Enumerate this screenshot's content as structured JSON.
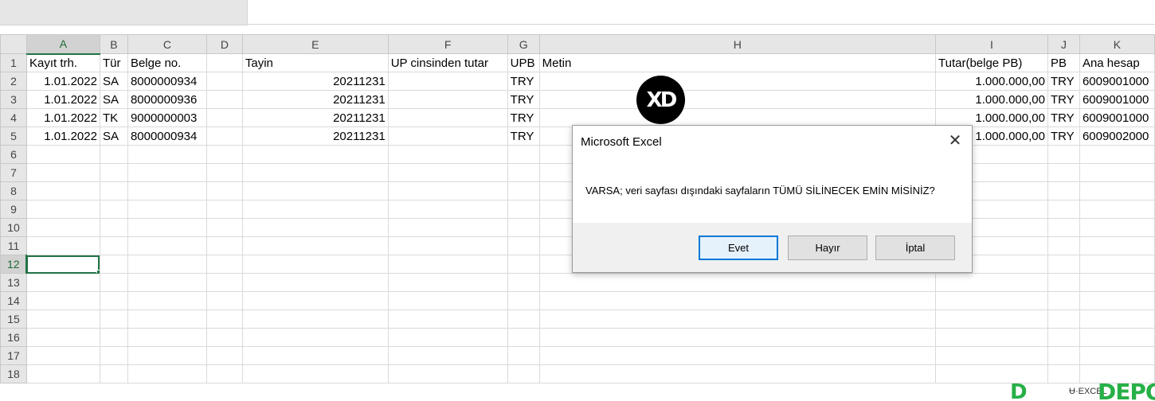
{
  "columns": [
    "A",
    "B",
    "C",
    "D",
    "E",
    "F",
    "G",
    "H",
    "I",
    "J",
    "K"
  ],
  "rows": [
    {
      "num": "1",
      "cells": [
        "Kayıt trh.",
        "Tür",
        "Belge no.",
        "",
        "Tayin",
        "UP cinsinden tutar",
        "UPB",
        "Metin",
        "Tutar(belge PB)",
        "PB",
        "Ana hesap"
      ]
    },
    {
      "num": "2",
      "cells": [
        "1.01.2022",
        "SA",
        "8000000934",
        "",
        "20211231",
        "",
        "TRY",
        "",
        "1.000.000,00",
        "TRY",
        "6009001000"
      ]
    },
    {
      "num": "3",
      "cells": [
        "1.01.2022",
        "SA",
        "8000000936",
        "",
        "20211231",
        "",
        "TRY",
        "",
        "1.000.000,00",
        "TRY",
        "6009001000"
      ]
    },
    {
      "num": "4",
      "cells": [
        "1.01.2022",
        "TK",
        "9000000003",
        "",
        "20211231",
        "",
        "TRY",
        "",
        "1.000.000,00",
        "TRY",
        "6009001000"
      ]
    },
    {
      "num": "5",
      "cells": [
        "1.01.2022",
        "SA",
        "8000000934",
        "",
        "20211231",
        "",
        "TRY",
        "",
        "1.000.000,00",
        "TRY",
        "6009002000"
      ]
    },
    {
      "num": "6",
      "cells": [
        "",
        "",
        "",
        "",
        "",
        "",
        "",
        "",
        "",
        "",
        ""
      ]
    },
    {
      "num": "7",
      "cells": [
        "",
        "",
        "",
        "",
        "",
        "",
        "",
        "",
        "",
        "",
        ""
      ]
    },
    {
      "num": "8",
      "cells": [
        "",
        "",
        "",
        "",
        "",
        "",
        "",
        "",
        "",
        "",
        ""
      ]
    },
    {
      "num": "9",
      "cells": [
        "",
        "",
        "",
        "",
        "",
        "",
        "",
        "",
        "",
        "",
        ""
      ]
    },
    {
      "num": "10",
      "cells": [
        "",
        "",
        "",
        "",
        "",
        "",
        "",
        "",
        "",
        "",
        ""
      ]
    },
    {
      "num": "11",
      "cells": [
        "",
        "",
        "",
        "",
        "",
        "",
        "",
        "",
        "",
        "",
        ""
      ]
    },
    {
      "num": "12",
      "cells": [
        "",
        "",
        "",
        "",
        "",
        "",
        "",
        "",
        "",
        "",
        ""
      ]
    },
    {
      "num": "13",
      "cells": [
        "",
        "",
        "",
        "",
        "",
        "",
        "",
        "",
        "",
        "",
        ""
      ]
    },
    {
      "num": "14",
      "cells": [
        "",
        "",
        "",
        "",
        "",
        "",
        "",
        "",
        "",
        "",
        ""
      ]
    },
    {
      "num": "15",
      "cells": [
        "",
        "",
        "",
        "",
        "",
        "",
        "",
        "",
        "",
        "",
        ""
      ]
    },
    {
      "num": "16",
      "cells": [
        "",
        "",
        "",
        "",
        "",
        "",
        "",
        "",
        "",
        "",
        ""
      ]
    },
    {
      "num": "17",
      "cells": [
        "",
        "",
        "",
        "",
        "",
        "",
        "",
        "",
        "",
        "",
        ""
      ]
    },
    {
      "num": "18",
      "cells": [
        "",
        "",
        "",
        "",
        "",
        "",
        "",
        "",
        "",
        "",
        ""
      ]
    }
  ],
  "selection": {
    "column": "A",
    "row": "12"
  },
  "logo": {
    "text": "XD"
  },
  "dialog": {
    "title": "Microsoft Excel",
    "message": "VARSA; veri sayfası dışındaki sayfaların TÜMÜ SİLİNECEK EMİN MİSİNİZ?",
    "buttons": {
      "yes": "Evet",
      "no": "Hayır",
      "cancel": "İptal"
    },
    "close_icon": "close-icon"
  },
  "watermark": {
    "left": "D",
    "mid": "Ʉ·EXCEL",
    "right": "DEPO"
  },
  "colors": {
    "selection_green": "#217346",
    "watermark_green": "#27b048",
    "default_button_border": "#0078d7"
  }
}
